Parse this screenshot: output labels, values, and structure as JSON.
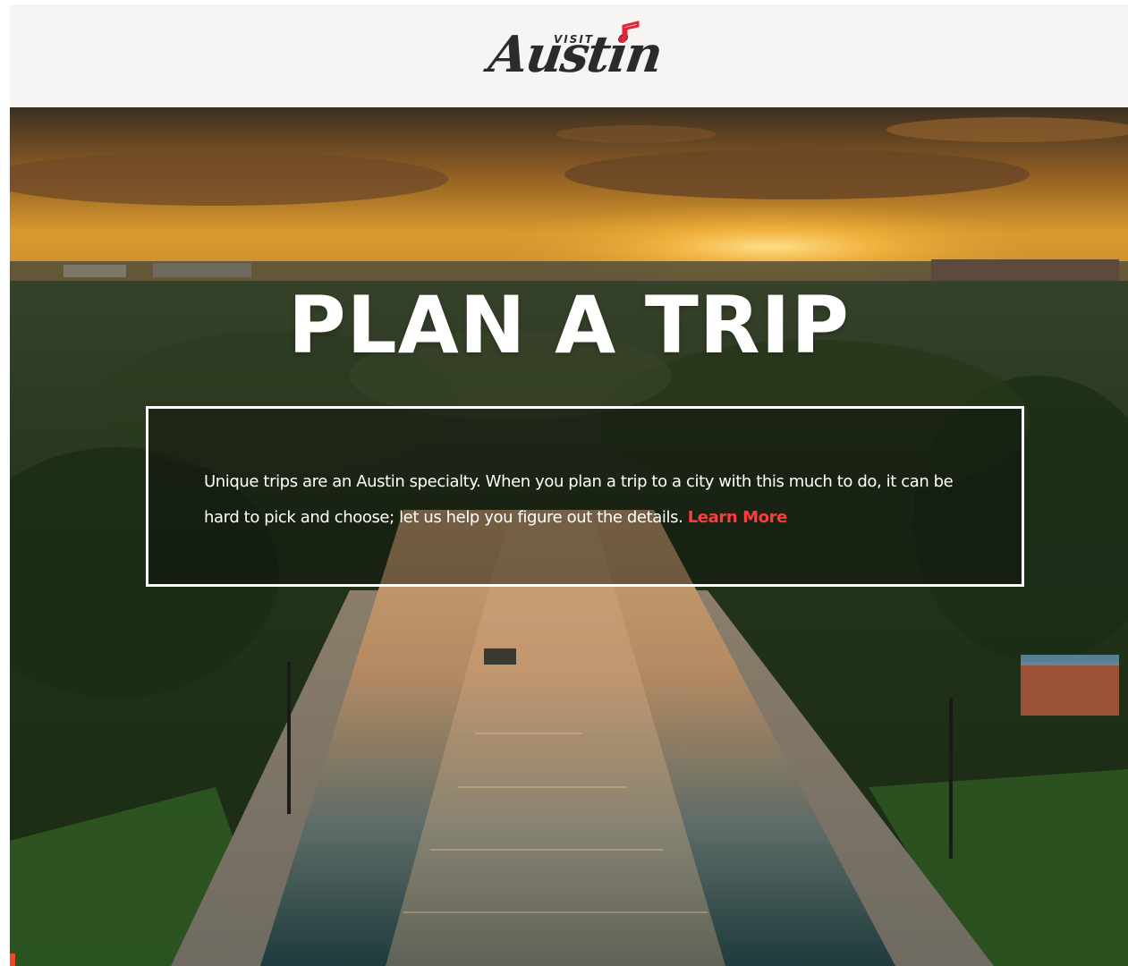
{
  "header": {
    "logo": {
      "visit_text": "VISIT",
      "city_text": "Austin",
      "accent_color": "#e0243c"
    }
  },
  "hero": {
    "title": "PLAN A TRIP",
    "intro": {
      "body": "Unique trips are an Austin specialty. When you plan a trip to a city with this much to do, it can be hard to pick and choose; let us help you figure out the details.",
      "link_label": "Learn More",
      "link_color": "#ff3b3b"
    },
    "image_description_icon": "aerial-river-photo"
  }
}
